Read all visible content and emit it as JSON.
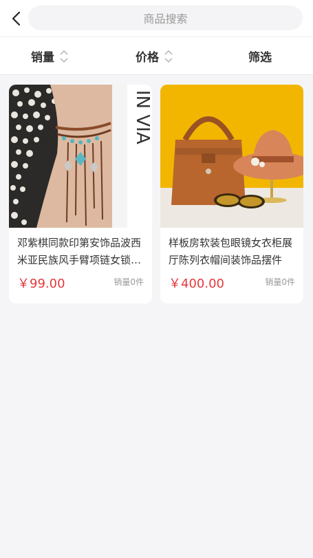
{
  "header": {
    "search_placeholder": "商品搜索"
  },
  "sort": {
    "sales_label": "销量",
    "price_label": "价格",
    "filter_label": "筛选"
  },
  "products": [
    {
      "title": "邓紫棋同款印第安饰品波西米亚民族风手臂项链女锁骨链",
      "price": "￥99.00",
      "sales": "销量0件",
      "image_text": "IN VIA"
    },
    {
      "title": "样板房软装包眼镜女衣柜展厅陈列衣帽间装饰品摆件",
      "price": "￥400.00",
      "sales": "销量0件"
    }
  ],
  "colors": {
    "price": "#e4393c",
    "background": "#f5f5f7",
    "product2_bg": "#f2b600"
  },
  "icons": {
    "back": "chevron-left-icon",
    "sort": "sort-updown-icon"
  }
}
